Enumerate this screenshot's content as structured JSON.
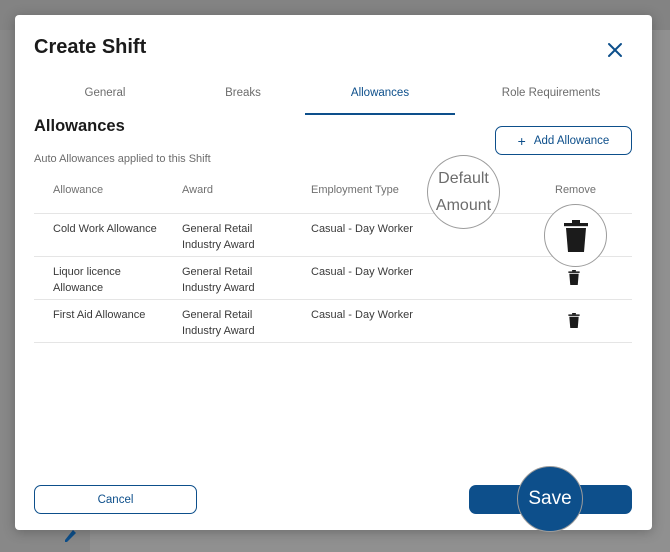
{
  "modal": {
    "title": "Create Shift",
    "tabs": [
      {
        "label": "General"
      },
      {
        "label": "Breaks"
      },
      {
        "label": "Allowances",
        "active": true
      },
      {
        "label": "Role Requirements"
      }
    ],
    "section_title": "Allowances",
    "add_button": "Add Allowance",
    "subtitle": "Auto Allowances applied to this Shift",
    "table": {
      "headers": {
        "allowance": "Allowance",
        "award": "Award",
        "employment_type": "Employment Type",
        "default_amount": "Default Amount",
        "remove": "Remove"
      },
      "rows": [
        {
          "allowance": "Cold Work Allowance",
          "award": "General Retail Industry Award",
          "employment_type": "Casual - Day Worker"
        },
        {
          "allowance": "Liquor licence Allowance",
          "award": "General Retail Industry Award",
          "employment_type": "Casual - Day Worker"
        },
        {
          "allowance": "First Aid Allowance",
          "award": "General Retail Industry Award",
          "employment_type": "Casual - Day Worker"
        }
      ]
    },
    "cancel_button": "Cancel",
    "save_button": "Save"
  },
  "colors": {
    "accent": "#0d4f8b",
    "overlay": "rgba(0,0,0,0.38)"
  }
}
